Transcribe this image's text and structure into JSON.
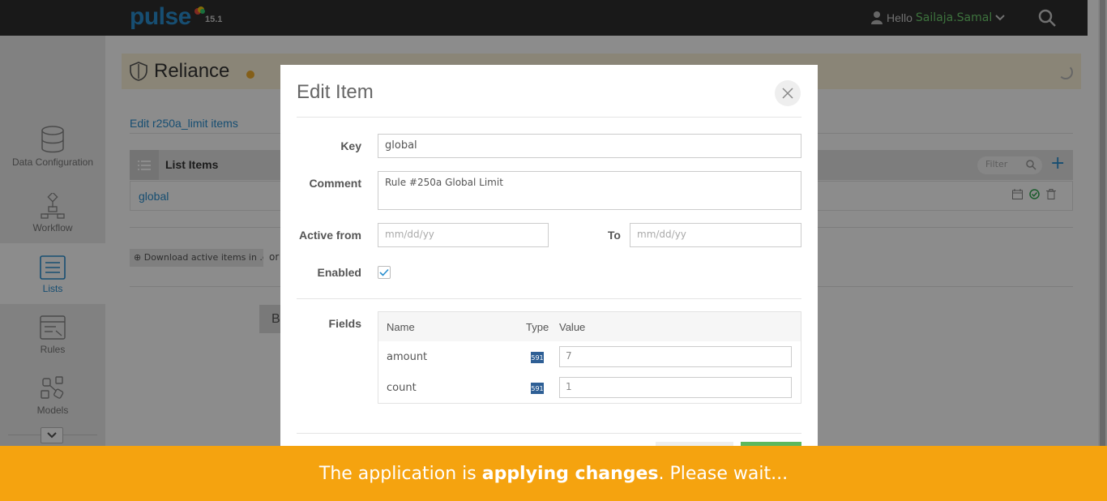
{
  "app": {
    "logo": "pulse",
    "version": "15.1"
  },
  "header": {
    "greeting": "Hello",
    "user": "Sailaja.Samal"
  },
  "sidebar": {
    "items": [
      {
        "label": "Data Configuration",
        "icon": "database-icon"
      },
      {
        "label": "Workflow",
        "icon": "workflow-icon"
      },
      {
        "label": "Lists",
        "icon": "list-icon",
        "active": true
      },
      {
        "label": "Rules",
        "icon": "rules-icon"
      },
      {
        "label": "Models",
        "icon": "models-icon"
      }
    ]
  },
  "project": {
    "name": "Reliance"
  },
  "page": {
    "edit_link": "Edit r250a_limit items",
    "list_header": "List Items",
    "filter_placeholder": "Filter",
    "rows": [
      "global"
    ],
    "download_label": "Download active items in .csv",
    "or_text": "or",
    "back_label": "B"
  },
  "modal": {
    "title": "Edit Item",
    "key_label": "Key",
    "key_value": "global",
    "comment_label": "Comment",
    "comment_value": "Rule #250a Global Limit",
    "active_from_label": "Active from",
    "active_from_placeholder": "mm/dd/yy",
    "to_label": "To",
    "to_placeholder": "mm/dd/yy",
    "enabled_label": "Enabled",
    "enabled": true,
    "fields_label": "Fields",
    "fields_columns": {
      "name": "Name",
      "type": "Type",
      "value": "Value"
    },
    "fields": [
      {
        "name": "amount",
        "type": "591",
        "value": "7"
      },
      {
        "name": "count",
        "type": "591",
        "value": "1"
      }
    ]
  },
  "toast": {
    "before": "The application is ",
    "bold": "applying changes",
    "after": ". Please wait..."
  },
  "colors": {
    "accent": "#2a8fcf",
    "toast": "#f5a30f",
    "topbar": "#2e2e2e",
    "project_bar": "#fcf3d9"
  }
}
